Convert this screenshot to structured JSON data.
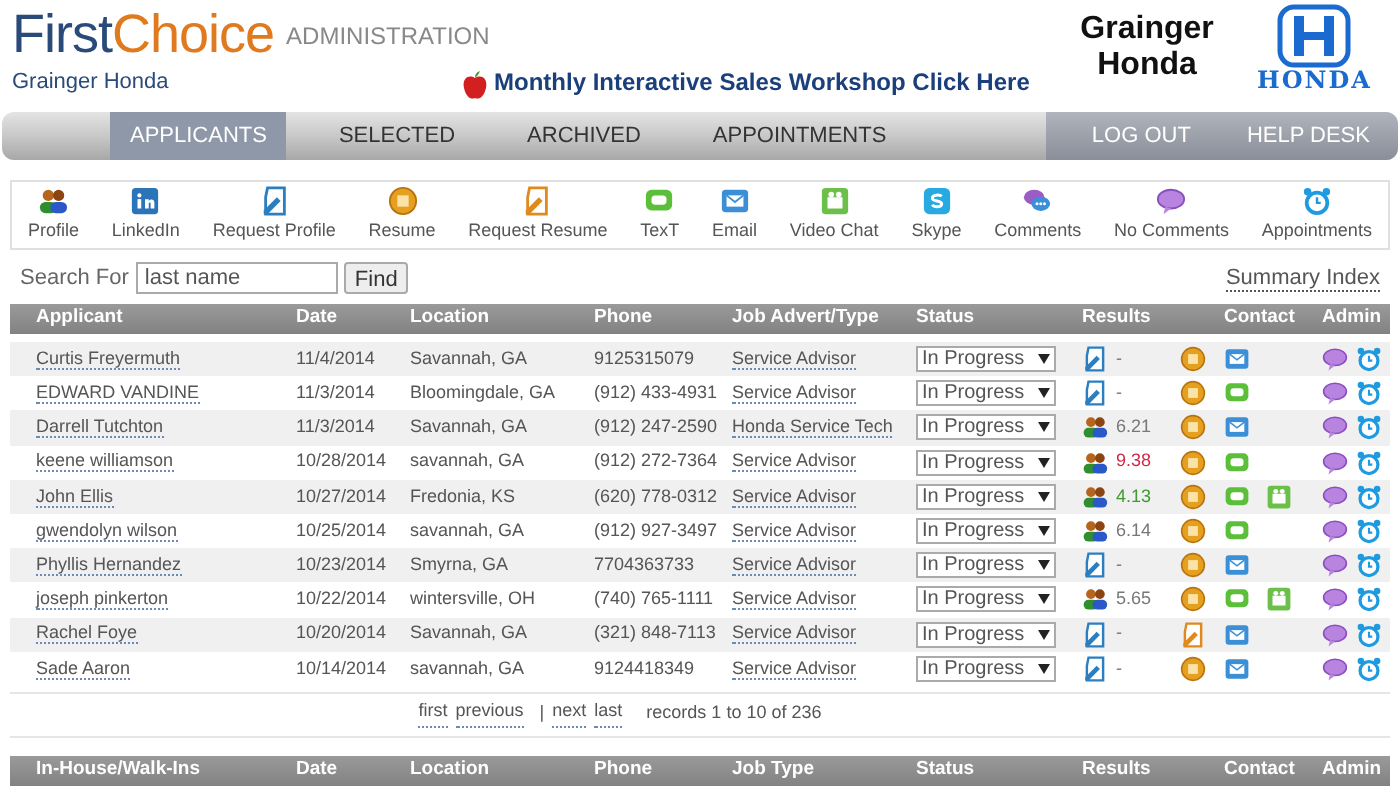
{
  "header": {
    "logo_first": "First",
    "logo_second": "Choice",
    "section": "ADMINISTRATION",
    "dealer": "Grainger Honda",
    "promo": "Monthly Interactive Sales Workshop Click Here",
    "brand_name": "Grainger Honda",
    "brand_mark": "HONDA"
  },
  "nav": {
    "left": [
      {
        "label": "APPLICANTS",
        "selected": true
      },
      {
        "label": "SELECTED",
        "selected": false
      },
      {
        "label": "ARCHIVED",
        "selected": false
      },
      {
        "label": "APPOINTMENTS",
        "selected": false
      }
    ],
    "right": [
      "LOG OUT",
      "HELP DESK"
    ]
  },
  "toolbar": [
    {
      "kind": "profile",
      "label": "Profile"
    },
    {
      "kind": "linkedin",
      "label": "LinkedIn"
    },
    {
      "kind": "request-profile",
      "label": "Request Profile"
    },
    {
      "kind": "resume",
      "label": "Resume"
    },
    {
      "kind": "request-resume",
      "label": "Request Resume"
    },
    {
      "kind": "text",
      "label": "TexT"
    },
    {
      "kind": "email",
      "label": "Email"
    },
    {
      "kind": "video",
      "label": "Video Chat"
    },
    {
      "kind": "skype",
      "label": "Skype"
    },
    {
      "kind": "comments",
      "label": "Comments"
    },
    {
      "kind": "no-comments",
      "label": "No Comments"
    },
    {
      "kind": "appointments",
      "label": "Appointments"
    }
  ],
  "search": {
    "label": "Search For",
    "value": "last name",
    "button": "Find",
    "summary_link": "Summary Index"
  },
  "table": {
    "columns": [
      "Applicant",
      "Date",
      "Location",
      "Phone",
      "Job Advert/Type",
      "Status",
      "Results",
      "Contact",
      "Admin"
    ],
    "rows": [
      {
        "applicant": "Curtis Freyermuth",
        "date": "11/4/2014",
        "location": "Savannah, GA",
        "phone": "9125315079",
        "job": "Service Advisor",
        "status": "In Progress",
        "result": {
          "kind": "request-profile",
          "score": "-",
          "color": "#777777"
        },
        "resume": {
          "kind": "resume"
        },
        "contact": [
          {
            "kind": "email"
          }
        ]
      },
      {
        "applicant": "EDWARD VANDINE",
        "date": "11/3/2014",
        "location": "Bloomingdale, GA",
        "phone": "(912) 433-4931",
        "job": "Service Advisor",
        "status": "In Progress",
        "result": {
          "kind": "request-profile",
          "score": "-",
          "color": "#777777"
        },
        "resume": {
          "kind": "resume"
        },
        "contact": [
          {
            "kind": "text"
          }
        ]
      },
      {
        "applicant": "Darrell Tutchton",
        "date": "11/3/2014",
        "location": "Savannah, GA",
        "phone": "(912) 247-2590",
        "job": "Honda Service Tech",
        "status": "In Progress",
        "result": {
          "kind": "profile",
          "score": "6.21",
          "color": "#777777"
        },
        "resume": {
          "kind": "resume"
        },
        "contact": [
          {
            "kind": "email"
          }
        ]
      },
      {
        "applicant": "keene williamson",
        "date": "10/28/2014",
        "location": "savannah, GA",
        "phone": "(912) 272-7364",
        "job": "Service Advisor",
        "status": "In Progress",
        "result": {
          "kind": "profile",
          "score": "9.38",
          "color": "#d0284a"
        },
        "resume": {
          "kind": "resume"
        },
        "contact": [
          {
            "kind": "text"
          }
        ]
      },
      {
        "applicant": "John Ellis",
        "date": "10/27/2014",
        "location": "Fredonia, KS",
        "phone": "(620) 778-0312",
        "job": "Service Advisor",
        "status": "In Progress",
        "result": {
          "kind": "profile",
          "score": "4.13",
          "color": "#3f9a2f"
        },
        "resume": {
          "kind": "resume"
        },
        "contact": [
          {
            "kind": "text"
          },
          {
            "kind": "video"
          }
        ]
      },
      {
        "applicant": "gwendolyn wilson",
        "date": "10/25/2014",
        "location": "savannah, GA",
        "phone": "(912) 927-3497",
        "job": "Service Advisor",
        "status": "In Progress",
        "result": {
          "kind": "profile",
          "score": "6.14",
          "color": "#777777"
        },
        "resume": {
          "kind": "resume"
        },
        "contact": [
          {
            "kind": "text"
          }
        ]
      },
      {
        "applicant": "Phyllis Hernandez",
        "date": "10/23/2014",
        "location": "Smyrna, GA",
        "phone": "7704363733",
        "job": "Service Advisor",
        "status": "In Progress",
        "result": {
          "kind": "request-profile",
          "score": "-",
          "color": "#777777"
        },
        "resume": {
          "kind": "resume"
        },
        "contact": [
          {
            "kind": "email"
          }
        ]
      },
      {
        "applicant": "joseph pinkerton",
        "date": "10/22/2014",
        "location": "wintersville, OH",
        "phone": "(740) 765-1111",
        "job": "Service Advisor",
        "status": "In Progress",
        "result": {
          "kind": "profile",
          "score": "5.65",
          "color": "#777777"
        },
        "resume": {
          "kind": "resume"
        },
        "contact": [
          {
            "kind": "text"
          },
          {
            "kind": "video"
          }
        ]
      },
      {
        "applicant": "Rachel Foye",
        "date": "10/20/2014",
        "location": "Savannah, GA",
        "phone": "(321) 848-7113",
        "job": "Service Advisor",
        "status": "In Progress",
        "result": {
          "kind": "request-profile",
          "score": "-",
          "color": "#777777"
        },
        "resume": {
          "kind": "request-resume"
        },
        "contact": [
          {
            "kind": "email"
          }
        ]
      },
      {
        "applicant": "Sade Aaron",
        "date": "10/14/2014",
        "location": "savannah, GA",
        "phone": "9124418349",
        "job": "Service Advisor",
        "status": "In Progress",
        "result": {
          "kind": "request-profile",
          "score": "-",
          "color": "#777777"
        },
        "resume": {
          "kind": "resume"
        },
        "contact": [
          {
            "kind": "email"
          }
        ]
      }
    ]
  },
  "pagination": {
    "links": [
      "first",
      "previous",
      "next",
      "last"
    ],
    "separator": "|",
    "records": "records 1 to 10 of 236"
  },
  "walkins_table": {
    "columns": [
      "In-House/Walk-Ins",
      "Date",
      "Location",
      "Phone",
      "Job Type",
      "Status",
      "Results",
      "Contact",
      "Admin"
    ]
  }
}
